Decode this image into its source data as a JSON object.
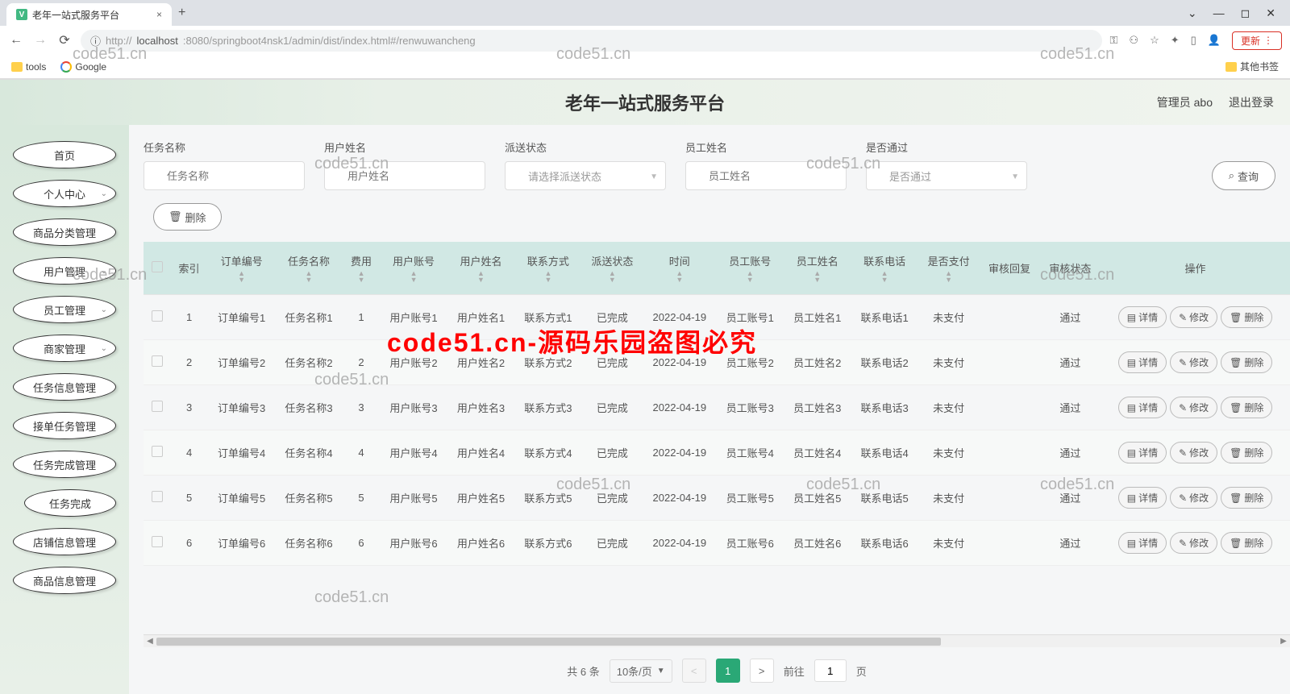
{
  "browser": {
    "tab_title": "老年一站式服务平台",
    "new_tab": "+",
    "url_prefix": "http://",
    "url_host": "localhost",
    "url_rest": ":8080/springboot4nsk1/admin/dist/index.html#/renwuwancheng",
    "update": "更新",
    "bookmarks": {
      "tools": "tools",
      "google": "Google",
      "other": "其他书签"
    }
  },
  "header": {
    "title": "老年一站式服务平台",
    "admin": "管理员 abo",
    "logout": "退出登录"
  },
  "sidebar": {
    "items": [
      {
        "label": "首页",
        "arrow": false
      },
      {
        "label": "个人中心",
        "arrow": true
      },
      {
        "label": "商品分类管理",
        "arrow": false
      },
      {
        "label": "用户管理",
        "arrow": true
      },
      {
        "label": "员工管理",
        "arrow": true
      },
      {
        "label": "商家管理",
        "arrow": true
      },
      {
        "label": "任务信息管理",
        "arrow": false
      },
      {
        "label": "接单任务管理",
        "arrow": false
      },
      {
        "label": "任务完成管理",
        "arrow": false
      },
      {
        "label": "任务完成",
        "arrow": false,
        "indent": true
      },
      {
        "label": "店铺信息管理",
        "arrow": false
      },
      {
        "label": "商品信息管理",
        "arrow": false
      }
    ]
  },
  "filters": {
    "task_name": {
      "label": "任务名称",
      "placeholder": "任务名称"
    },
    "user_name": {
      "label": "用户姓名",
      "placeholder": "用户姓名"
    },
    "delivery": {
      "label": "派送状态",
      "placeholder": "请选择派送状态"
    },
    "emp_name": {
      "label": "员工姓名",
      "placeholder": "员工姓名"
    },
    "pass": {
      "label": "是否通过",
      "placeholder": "是否通过"
    },
    "query": "查询"
  },
  "toolbar": {
    "delete": "删除"
  },
  "table": {
    "headers": [
      "",
      "索引",
      "订单编号",
      "任务名称",
      "费用",
      "用户账号",
      "用户姓名",
      "联系方式",
      "派送状态",
      "时间",
      "员工账号",
      "员工姓名",
      "联系电话",
      "是否支付",
      "审核回复",
      "审核状态",
      "操作"
    ],
    "rows": [
      {
        "idx": "1",
        "order": "订单编号1",
        "task": "任务名称1",
        "fee": "1",
        "uacc": "用户账号1",
        "uname": "用户姓名1",
        "contact": "联系方式1",
        "status": "已完成",
        "time": "2022-04-19",
        "eacc": "员工账号1",
        "ename": "员工姓名1",
        "phone": "联系电话1",
        "paid": "未支付",
        "reply": "",
        "audit": "通过"
      },
      {
        "idx": "2",
        "order": "订单编号2",
        "task": "任务名称2",
        "fee": "2",
        "uacc": "用户账号2",
        "uname": "用户姓名2",
        "contact": "联系方式2",
        "status": "已完成",
        "time": "2022-04-19",
        "eacc": "员工账号2",
        "ename": "员工姓名2",
        "phone": "联系电话2",
        "paid": "未支付",
        "reply": "",
        "audit": "通过"
      },
      {
        "idx": "3",
        "order": "订单编号3",
        "task": "任务名称3",
        "fee": "3",
        "uacc": "用户账号3",
        "uname": "用户姓名3",
        "contact": "联系方式3",
        "status": "已完成",
        "time": "2022-04-19",
        "eacc": "员工账号3",
        "ename": "员工姓名3",
        "phone": "联系电话3",
        "paid": "未支付",
        "reply": "",
        "audit": "通过"
      },
      {
        "idx": "4",
        "order": "订单编号4",
        "task": "任务名称4",
        "fee": "4",
        "uacc": "用户账号4",
        "uname": "用户姓名4",
        "contact": "联系方式4",
        "status": "已完成",
        "time": "2022-04-19",
        "eacc": "员工账号4",
        "ename": "员工姓名4",
        "phone": "联系电话4",
        "paid": "未支付",
        "reply": "",
        "audit": "通过"
      },
      {
        "idx": "5",
        "order": "订单编号5",
        "task": "任务名称5",
        "fee": "5",
        "uacc": "用户账号5",
        "uname": "用户姓名5",
        "contact": "联系方式5",
        "status": "已完成",
        "time": "2022-04-19",
        "eacc": "员工账号5",
        "ename": "员工姓名5",
        "phone": "联系电话5",
        "paid": "未支付",
        "reply": "",
        "audit": "通过"
      },
      {
        "idx": "6",
        "order": "订单编号6",
        "task": "任务名称6",
        "fee": "6",
        "uacc": "用户账号6",
        "uname": "用户姓名6",
        "contact": "联系方式6",
        "status": "已完成",
        "time": "2022-04-19",
        "eacc": "员工账号6",
        "ename": "员工姓名6",
        "phone": "联系电话6",
        "paid": "未支付",
        "reply": "",
        "audit": "通过"
      }
    ],
    "ops": {
      "detail": "详情",
      "edit": "修改",
      "del": "删除"
    }
  },
  "pagination": {
    "total": "共 6 条",
    "per_page": "10条/页",
    "page": "1",
    "goto": "前往",
    "goto_val": "1",
    "page_suffix": "页"
  },
  "watermarks": [
    "code51.cn",
    "code51.cn",
    "code51.cn",
    "code51.cn",
    "code51.cn",
    "code51.cn",
    "code51.cn",
    "code51.cn",
    "code51.cn",
    "code51.cn",
    "code51.cn",
    "code51.cn"
  ],
  "overlay": "code51.cn-源码乐园盗图必究"
}
